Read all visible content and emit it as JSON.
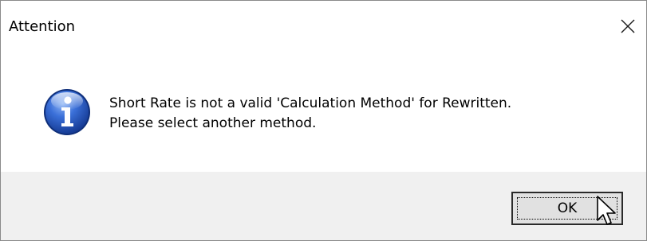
{
  "window": {
    "title": "Attention",
    "close_icon": "close-icon"
  },
  "message": {
    "icon": "info-icon",
    "line1": "Short Rate is not a valid 'Calculation Method' for Rewritten.",
    "line2": "Please select another method."
  },
  "buttons": {
    "ok_label": "OK"
  },
  "colors": {
    "info_icon_blue": "#1f4fb8",
    "footer_bg": "#f0f0f0",
    "button_bg": "#e1e1e1"
  }
}
